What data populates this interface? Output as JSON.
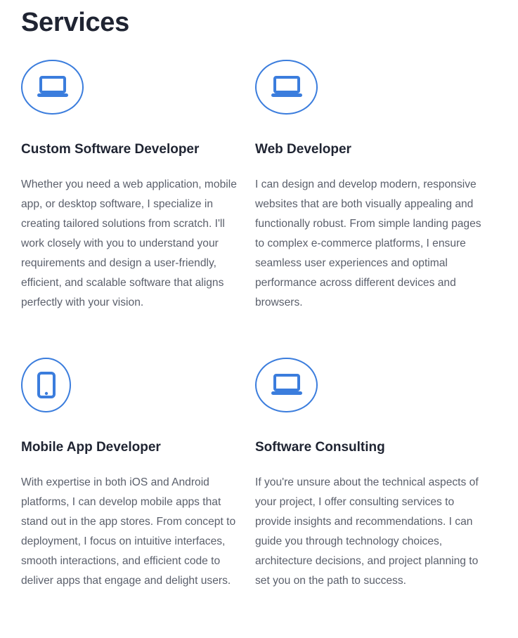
{
  "page": {
    "title": "Services",
    "accent_color": "#3b7ddd"
  },
  "services": [
    {
      "icon": "laptop-icon",
      "title": "Custom Software Developer",
      "description": "Whether you need a web application, mobile app, or desktop software, I specialize in creating tailored solutions from scratch. I'll work closely with you to understand your requirements and design a user-friendly, efficient, and scalable software that aligns perfectly with your vision."
    },
    {
      "icon": "laptop-icon",
      "title": "Web Developer",
      "description": "I can design and develop modern, responsive websites that are both visually appealing and functionally robust. From simple landing pages to complex e-commerce platforms, I ensure seamless user experiences and optimal performance across different devices and browsers."
    },
    {
      "icon": "mobile-phone-icon",
      "title": "Mobile App Developer",
      "description": "With expertise in both iOS and Android platforms, I can develop mobile apps that stand out in the app stores. From concept to deployment, I focus on intuitive interfaces, smooth interactions, and efficient code to deliver apps that engage and delight users."
    },
    {
      "icon": "laptop-icon",
      "title": "Software Consulting",
      "description": "If you're unsure about the technical aspects of your project, I offer consulting services to provide insights and recommendations. I can guide you through technology choices, architecture decisions, and project planning to set you on the path to success."
    }
  ]
}
